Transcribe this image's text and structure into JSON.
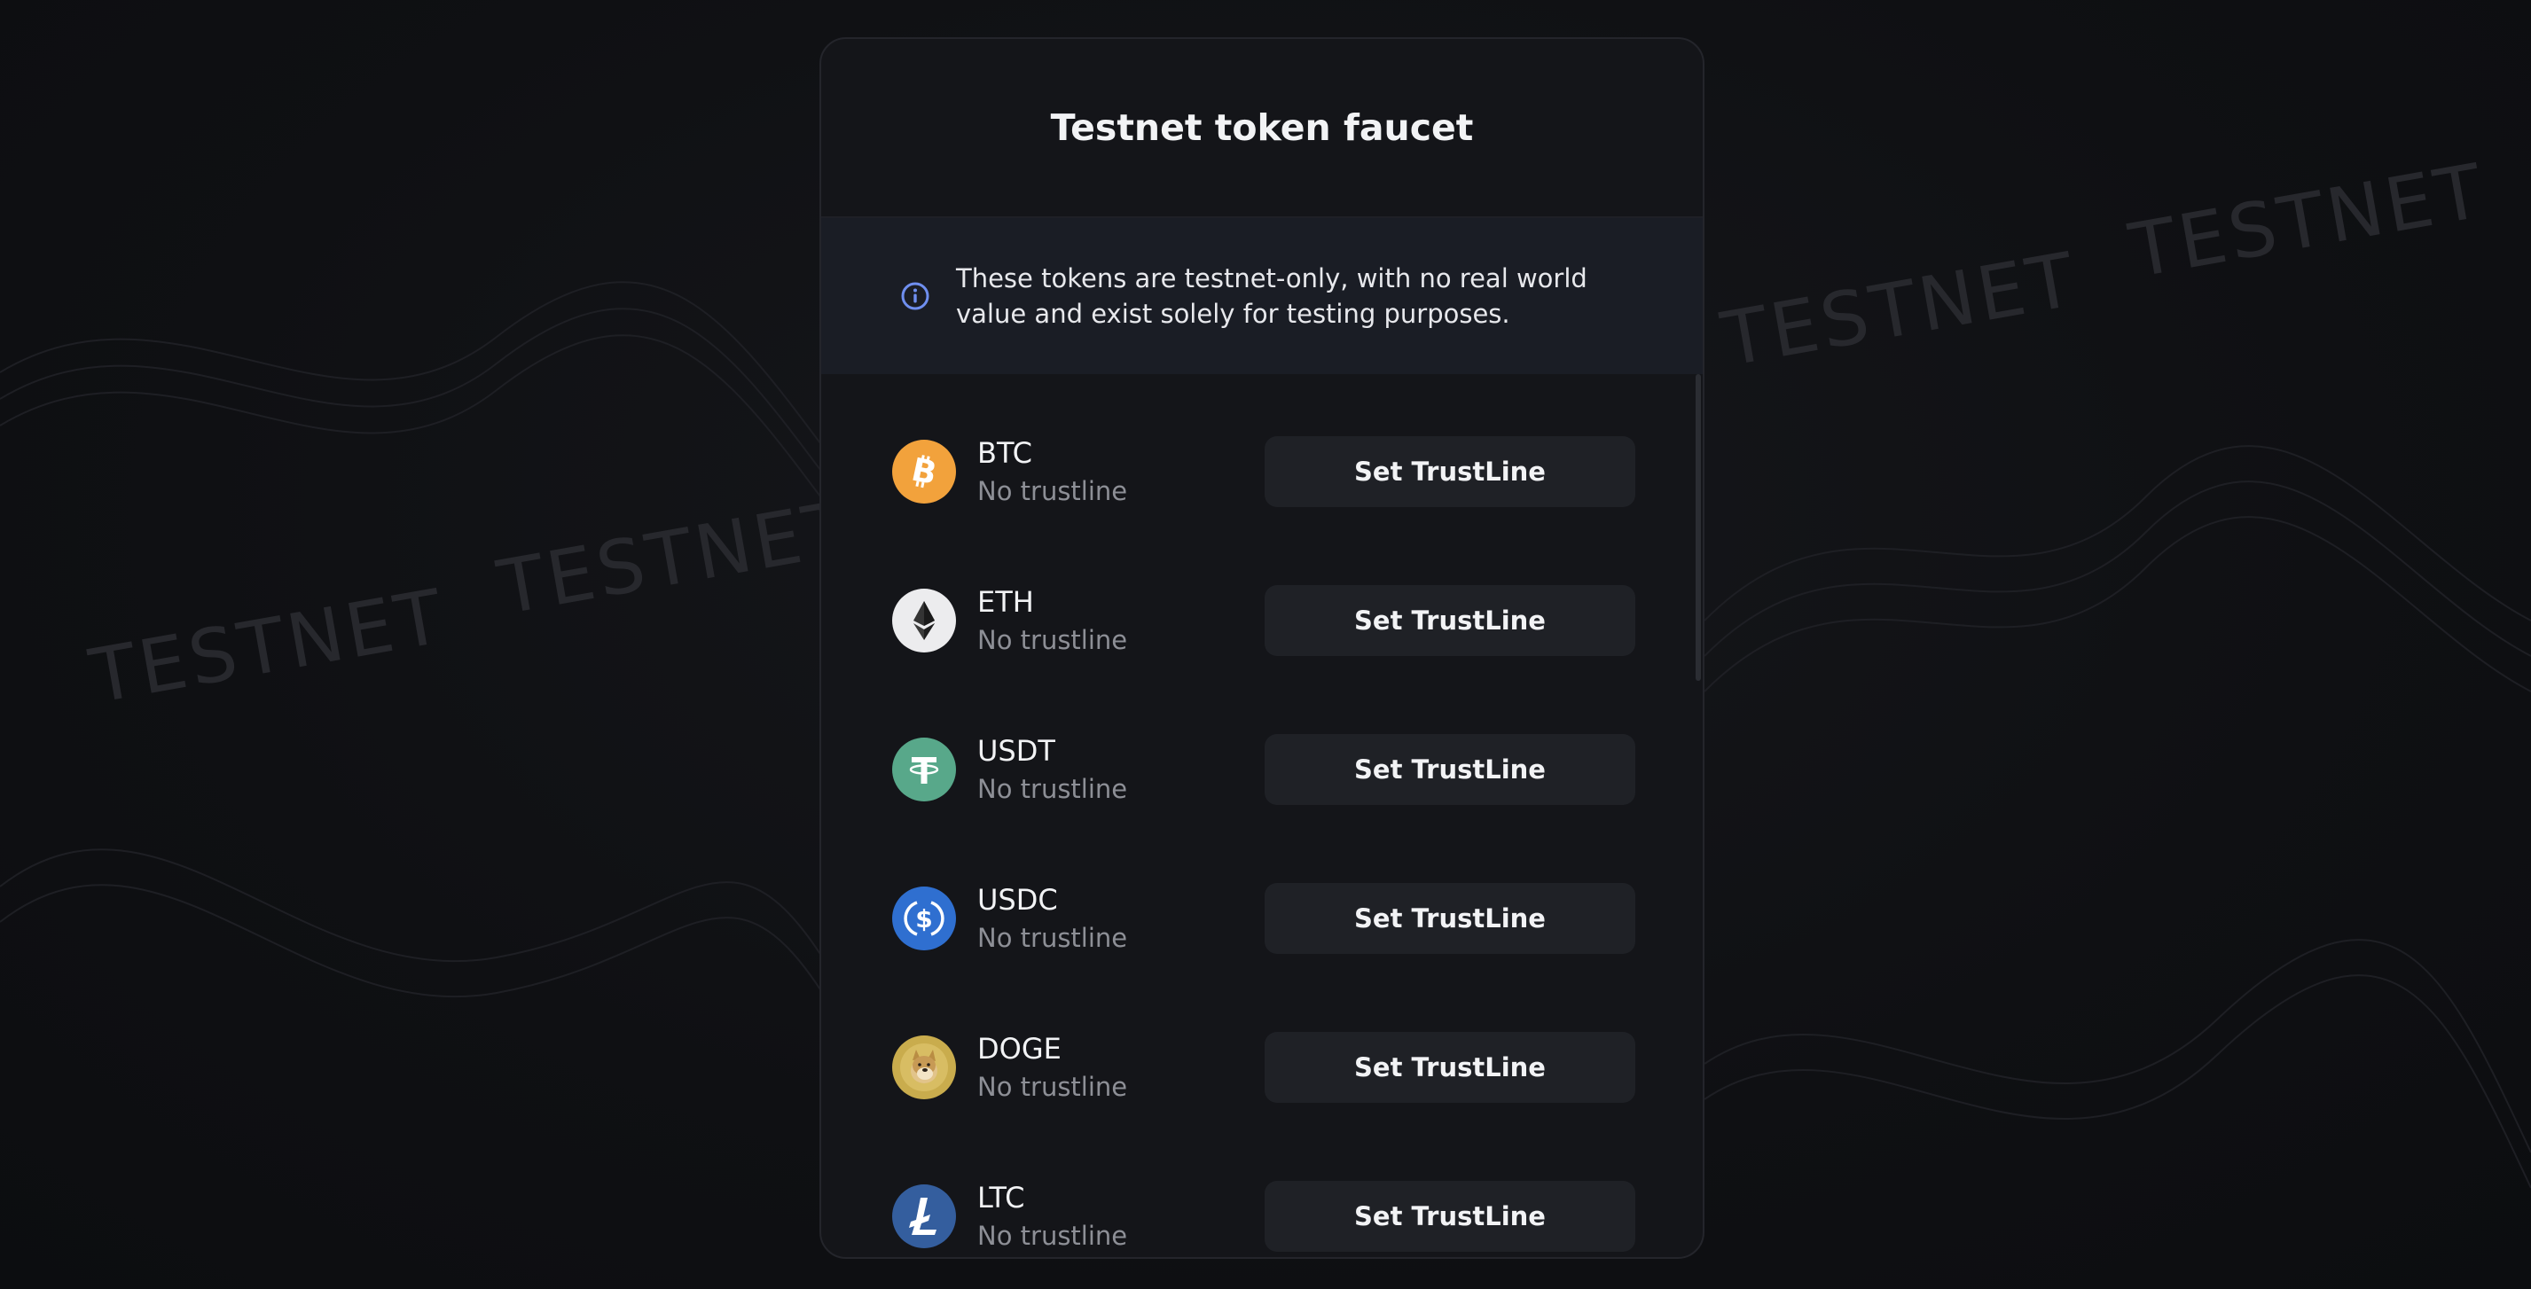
{
  "background": {
    "watermark_text": "TESTNET"
  },
  "card": {
    "title": "Testnet token faucet",
    "notice": {
      "icon": "info-icon",
      "text": "These tokens are testnet-only, with no real world value and exist solely for testing purposes."
    },
    "tokens": [
      {
        "symbol": "BTC",
        "status": "No trustline",
        "button_label": "Set TrustLine",
        "icon": "bitcoin-icon",
        "color": "#f2a23c"
      },
      {
        "symbol": "ETH",
        "status": "No trustline",
        "button_label": "Set TrustLine",
        "icon": "ethereum-icon",
        "color": "#ececee"
      },
      {
        "symbol": "USDT",
        "status": "No trustline",
        "button_label": "Set TrustLine",
        "icon": "tether-icon",
        "color": "#58a88a"
      },
      {
        "symbol": "USDC",
        "status": "No trustline",
        "button_label": "Set TrustLine",
        "icon": "usdc-icon",
        "color": "#2f6fd0"
      },
      {
        "symbol": "DOGE",
        "status": "No trustline",
        "button_label": "Set TrustLine",
        "icon": "dogecoin-icon",
        "color": "#c9ac4d"
      },
      {
        "symbol": "LTC",
        "status": "No trustline",
        "button_label": "Set TrustLine",
        "icon": "litecoin-icon",
        "color": "#345e9e"
      }
    ]
  }
}
